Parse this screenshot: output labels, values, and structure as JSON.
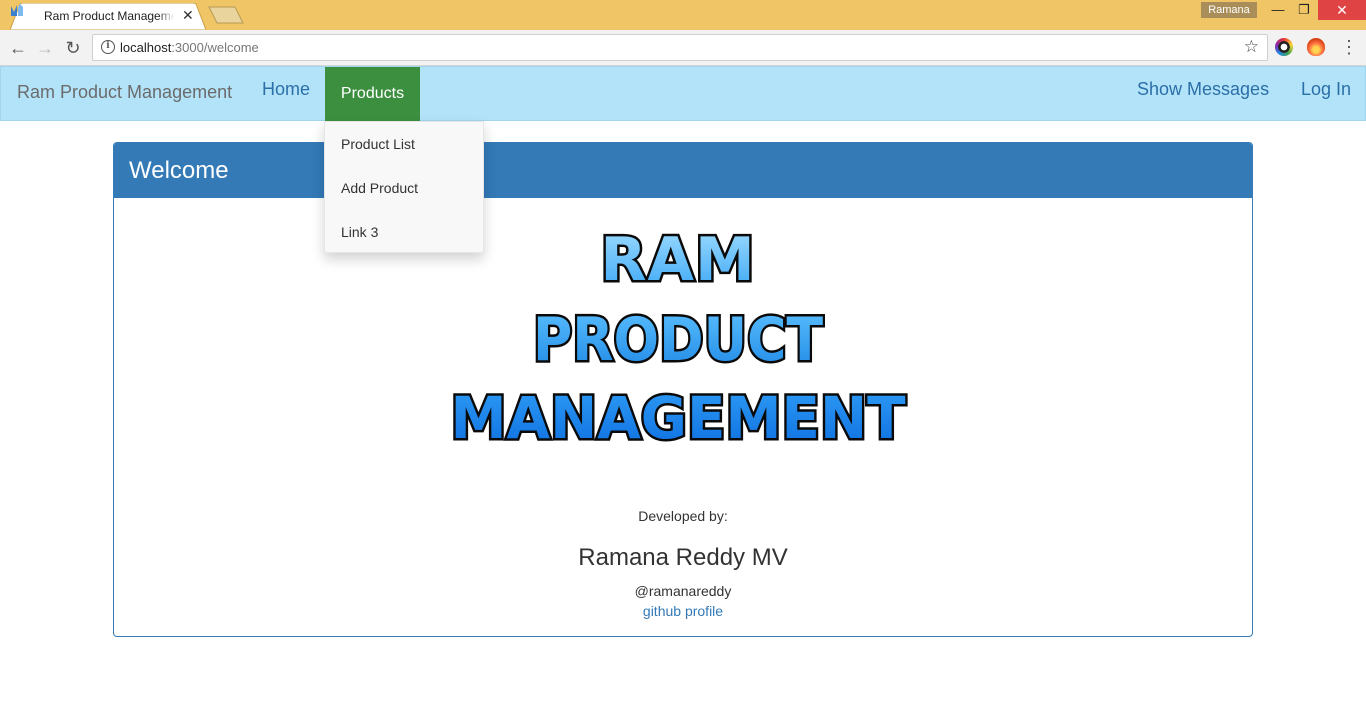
{
  "browser": {
    "tab_title": "Ram Product Management",
    "profile_name": "Ramana",
    "url_host": "localhost",
    "url_path": ":3000/welcome"
  },
  "navbar": {
    "brand": "Ram Product Management",
    "items": [
      {
        "label": "Home"
      },
      {
        "label": "Products"
      },
      {
        "label": "Show Messages"
      },
      {
        "label": "Log In"
      }
    ],
    "active_color": "#3c8f3f",
    "background": "#b3e3f9"
  },
  "products_dropdown": {
    "items": [
      {
        "label": "Product List"
      },
      {
        "label": "Add Product"
      },
      {
        "label": "Link 3"
      }
    ]
  },
  "panel": {
    "heading": "Welcome",
    "logo_lines": [
      "RAM",
      "PRODUCT",
      "MANAGEMENT"
    ],
    "developed_by_label": "Developed by:",
    "developer_name": "Ramana Reddy MV",
    "developer_handle": "@ramanareddy",
    "profile_link": "github profile",
    "accent": "#337ab7"
  }
}
